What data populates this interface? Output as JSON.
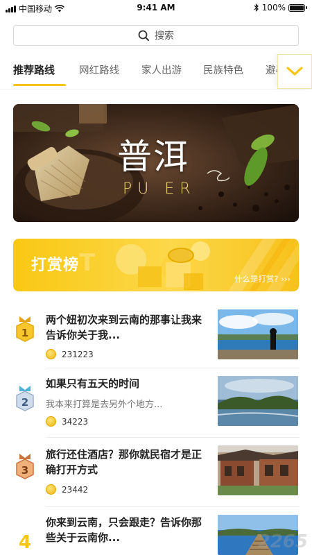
{
  "status_bar": {
    "carrier": "中国移动",
    "time": "9:41 AM",
    "battery": "100%"
  },
  "search": {
    "placeholder": "搜索",
    "icon": "search-icon"
  },
  "tabs": [
    {
      "label": "推荐路线",
      "active": true
    },
    {
      "label": "网红路线",
      "active": false
    },
    {
      "label": "家人出游",
      "active": false
    },
    {
      "label": "民族特色",
      "active": false
    },
    {
      "label": "避暑",
      "active": false
    }
  ],
  "tab_toggle_icon": "chevron-down-icon",
  "banner": {
    "title": "普洱",
    "subtitle": "PU ER"
  },
  "reward": {
    "title": "打赏榜",
    "link": "什么是打赏? ›››"
  },
  "list": [
    {
      "rank": "1",
      "title": "两个妞初次来到云南的那事让我来告诉你关于我...",
      "desc": "",
      "count": "231223"
    },
    {
      "rank": "2",
      "title": "如果只有五天的时间",
      "desc": "我本来打算是去另外个地方...",
      "count": "34223"
    },
    {
      "rank": "3",
      "title": "旅行还住酒店？那你就民宿才是正确打开方式",
      "desc": "",
      "count": "23442"
    },
    {
      "rank": "4",
      "title": "你来到云南，只会跟走？告诉你那些关于云南你...",
      "desc": "",
      "count": ""
    }
  ],
  "colors": {
    "accent": "#f5c518",
    "gold": "#e8a400",
    "silver": "#8fa8c8",
    "bronze": "#c9743f"
  },
  "watermark": "2265"
}
